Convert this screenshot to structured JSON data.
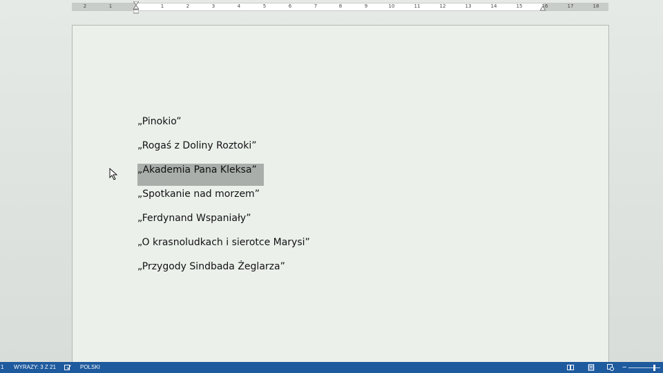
{
  "ruler": {
    "labels": [
      "2",
      "1",
      "1",
      "2",
      "3",
      "4",
      "5",
      "6",
      "7",
      "8",
      "9",
      "10",
      "11",
      "12",
      "13",
      "14",
      "15",
      "16",
      "17",
      "18"
    ]
  },
  "document": {
    "paragraphs": [
      "„Pinokio”",
      "„Rogaś z Doliny Roztoki”",
      "„Akademia Pana Kleksa”",
      "„Spotkanie nad morzem”",
      "„Ferdynand Wspaniały”",
      "„O krasnoludkach i sierotce Marysi”",
      "„Przygody Sindbada Żeglarza”"
    ],
    "selected_index": 2
  },
  "status_bar": {
    "page": "1",
    "words": "WYRAZY: 3 Z 21",
    "language": "POLSKI",
    "color": "#1e5a9e"
  },
  "icons": {
    "proofing": "proofing-icon",
    "read_mode": "read-mode-icon",
    "print_layout": "print-layout-icon",
    "web_layout": "web-layout-icon"
  }
}
